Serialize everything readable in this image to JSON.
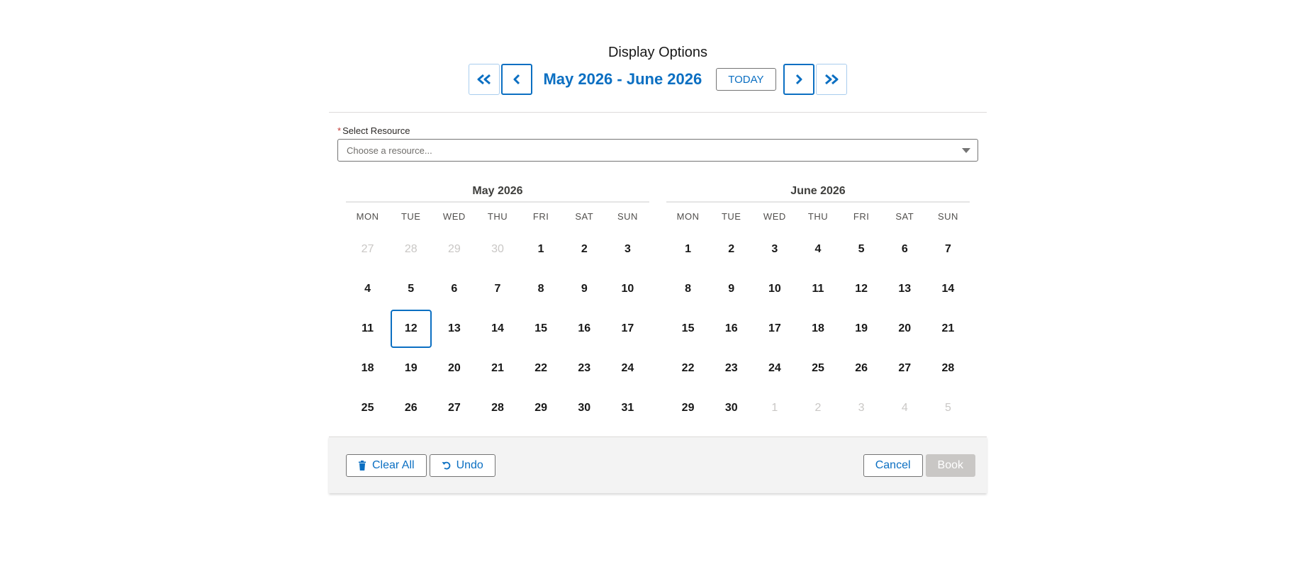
{
  "header": {
    "title": "Display Options",
    "range_label": "May 2026 - June 2026",
    "today_label": "TODAY",
    "nav_icons": [
      "double-chevron-left-icon",
      "chevron-left-icon",
      "chevron-right-icon",
      "double-chevron-right-icon"
    ]
  },
  "resource": {
    "required_marker": "*",
    "label": "Select Resource",
    "placeholder": "Choose a resource..."
  },
  "weekdays": [
    "MON",
    "TUE",
    "WED",
    "THU",
    "FRI",
    "SAT",
    "SUN"
  ],
  "calendars": [
    {
      "title": "May 2026",
      "days": [
        {
          "n": "27",
          "muted": true
        },
        {
          "n": "28",
          "muted": true
        },
        {
          "n": "29",
          "muted": true
        },
        {
          "n": "30",
          "muted": true
        },
        {
          "n": "1"
        },
        {
          "n": "2"
        },
        {
          "n": "3"
        },
        {
          "n": "4"
        },
        {
          "n": "5"
        },
        {
          "n": "6"
        },
        {
          "n": "7"
        },
        {
          "n": "8"
        },
        {
          "n": "9"
        },
        {
          "n": "10"
        },
        {
          "n": "11"
        },
        {
          "n": "12",
          "today": true
        },
        {
          "n": "13"
        },
        {
          "n": "14"
        },
        {
          "n": "15"
        },
        {
          "n": "16"
        },
        {
          "n": "17"
        },
        {
          "n": "18"
        },
        {
          "n": "19"
        },
        {
          "n": "20"
        },
        {
          "n": "21"
        },
        {
          "n": "22"
        },
        {
          "n": "23"
        },
        {
          "n": "24"
        },
        {
          "n": "25"
        },
        {
          "n": "26"
        },
        {
          "n": "27"
        },
        {
          "n": "28"
        },
        {
          "n": "29"
        },
        {
          "n": "30"
        },
        {
          "n": "31"
        }
      ]
    },
    {
      "title": "June 2026",
      "days": [
        {
          "n": "1"
        },
        {
          "n": "2"
        },
        {
          "n": "3"
        },
        {
          "n": "4"
        },
        {
          "n": "5"
        },
        {
          "n": "6"
        },
        {
          "n": "7"
        },
        {
          "n": "8"
        },
        {
          "n": "9"
        },
        {
          "n": "10"
        },
        {
          "n": "11"
        },
        {
          "n": "12"
        },
        {
          "n": "13"
        },
        {
          "n": "14"
        },
        {
          "n": "15"
        },
        {
          "n": "16"
        },
        {
          "n": "17"
        },
        {
          "n": "18"
        },
        {
          "n": "19"
        },
        {
          "n": "20"
        },
        {
          "n": "21"
        },
        {
          "n": "22"
        },
        {
          "n": "23"
        },
        {
          "n": "24"
        },
        {
          "n": "25"
        },
        {
          "n": "26"
        },
        {
          "n": "27"
        },
        {
          "n": "28"
        },
        {
          "n": "29"
        },
        {
          "n": "30"
        },
        {
          "n": "1",
          "muted": true
        },
        {
          "n": "2",
          "muted": true
        },
        {
          "n": "3",
          "muted": true
        },
        {
          "n": "4",
          "muted": true
        },
        {
          "n": "5",
          "muted": true
        }
      ]
    }
  ],
  "footer": {
    "clear_all_label": "Clear All",
    "undo_label": "Undo",
    "cancel_label": "Cancel",
    "book_label": "Book"
  },
  "colors": {
    "accent": "#0b6fc2",
    "muted_day": "#c9c7c5",
    "disabled_button": "#c9c7c5",
    "footer_bg": "#f3f3f3"
  }
}
